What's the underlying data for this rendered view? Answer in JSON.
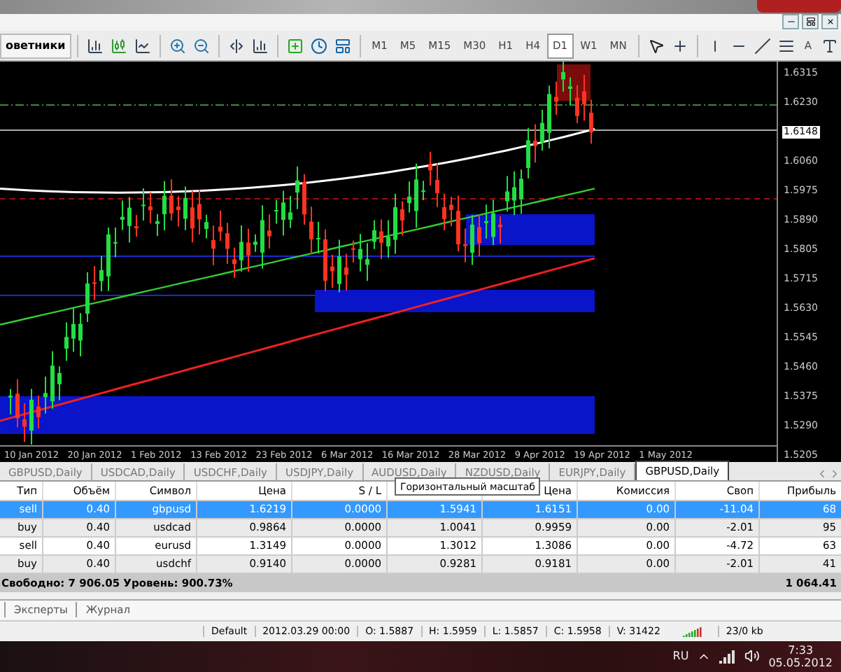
{
  "toolbar": {
    "experts_label": "оветники",
    "text_tool": "A",
    "timeframes": [
      {
        "label": "M1",
        "selected": false
      },
      {
        "label": "M5",
        "selected": false
      },
      {
        "label": "M15",
        "selected": false
      },
      {
        "label": "M30",
        "selected": false
      },
      {
        "label": "H1",
        "selected": false
      },
      {
        "label": "H4",
        "selected": false
      },
      {
        "label": "D1",
        "selected": true
      },
      {
        "label": "W1",
        "selected": false
      },
      {
        "label": "MN",
        "selected": false
      }
    ]
  },
  "chart": {
    "price_axis": [
      {
        "label": "1.6315",
        "kind": "tick"
      },
      {
        "label": "1.6230",
        "kind": "tick"
      },
      {
        "label": "1.6148",
        "kind": "current"
      },
      {
        "label": "1.6060",
        "kind": "tick"
      },
      {
        "label": "1.5975",
        "kind": "tick"
      },
      {
        "label": "1.5890",
        "kind": "tick"
      },
      {
        "label": "1.5805",
        "kind": "tick"
      },
      {
        "label": "1.5715",
        "kind": "tick"
      },
      {
        "label": "1.5630",
        "kind": "tick"
      },
      {
        "label": "1.5545",
        "kind": "tick"
      },
      {
        "label": "1.5460",
        "kind": "tick"
      },
      {
        "label": "1.5375",
        "kind": "tick"
      },
      {
        "label": "1.5290",
        "kind": "tick"
      },
      {
        "label": "1.5205",
        "kind": "tick"
      }
    ],
    "date_axis": [
      "10 Jan 2012",
      "20 Jan 2012",
      "1 Feb 2012",
      "13 Feb 2012",
      "23 Feb 2012",
      "6 Mar 2012",
      "16 Mar 2012",
      "28 Mar 2012",
      "9 Apr 2012",
      "19 Apr 2012",
      "1 May 2012"
    ]
  },
  "chart_tabs": [
    {
      "label": "GBPUSD,Daily",
      "selected": false
    },
    {
      "label": "USDCAD,Daily",
      "selected": false
    },
    {
      "label": "USDCHF,Daily",
      "selected": false
    },
    {
      "label": "USDJPY,Daily",
      "selected": false
    },
    {
      "label": "AUDUSD,Daily",
      "selected": false
    },
    {
      "label": "NZDUSD,Daily",
      "selected": false
    },
    {
      "label": "EURJPY,Daily",
      "selected": false
    },
    {
      "label": "GBPUSD,Daily",
      "selected": true
    }
  ],
  "tooltip": "Горизонтальный масштаб",
  "orders": {
    "columns": [
      {
        "label": "Тип"
      },
      {
        "label": "Объём"
      },
      {
        "label": "Символ"
      },
      {
        "label": "Цена"
      },
      {
        "label": "S / L"
      },
      {},
      {
        "label": "Цена"
      },
      {
        "label": "Комиссия"
      },
      {
        "label": "Своп"
      },
      {
        "label": "Прибыль"
      }
    ],
    "rows": [
      {
        "selected": true,
        "cells": [
          "sell",
          "0.40",
          "gbpusd",
          "1.6219",
          "0.0000",
          "1.5941",
          "1.6151",
          "0.00",
          "-11.04",
          "68"
        ]
      },
      {
        "selected": false,
        "cells": [
          "buy",
          "0.40",
          "usdcad",
          "0.9864",
          "0.0000",
          "1.0041",
          "0.9959",
          "0.00",
          "-2.01",
          "95"
        ]
      },
      {
        "selected": false,
        "cells": [
          "sell",
          "0.40",
          "eurusd",
          "1.3149",
          "0.0000",
          "1.3012",
          "1.3086",
          "0.00",
          "-4.72",
          "63"
        ]
      },
      {
        "selected": false,
        "cells": [
          "buy",
          "0.40",
          "usdchf",
          "0.9140",
          "0.0000",
          "0.9281",
          "0.9181",
          "0.00",
          "-2.01",
          "41"
        ]
      }
    ],
    "summary": "Свободно: 7 906.05  Уровень: 900.73%",
    "total": "1 064.41"
  },
  "terminal_tabs": [
    {
      "label": "Эксперты"
    },
    {
      "label": "Журнал"
    }
  ],
  "status_bar": [
    "Default",
    "2012.03.29 00:00",
    "O: 1.5887",
    "H: 1.5959",
    "L: 1.5857",
    "C: 1.5958",
    "V: 31422",
    "23/0 kb"
  ],
  "taskbar": {
    "language": "RU",
    "time": "7:33",
    "date": "05.05.2012"
  }
}
